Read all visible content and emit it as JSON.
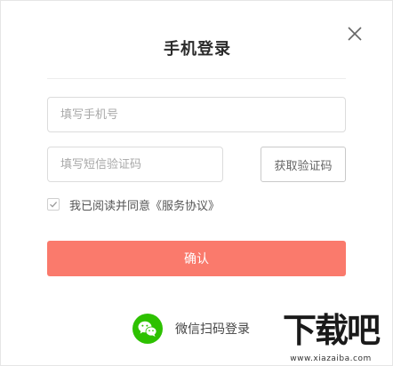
{
  "dialog": {
    "title": "手机登录",
    "close_icon": "close-icon"
  },
  "form": {
    "phone_placeholder": "填写手机号",
    "code_placeholder": "填写短信验证码",
    "get_code_label": "获取验证码",
    "agreement_text": "我已阅读并同意《服务协议》",
    "agreement_checked": true,
    "confirm_label": "确认"
  },
  "alt_login": {
    "wechat_icon": "wechat-icon",
    "wechat_label": "微信扫码登录"
  },
  "watermark": {
    "brand": "下载吧",
    "url": "www.xiazaiba.com"
  },
  "colors": {
    "confirm_button": "#fa7a6c",
    "wechat_green": "#2dc100",
    "title_text": "#2b2b2b"
  }
}
